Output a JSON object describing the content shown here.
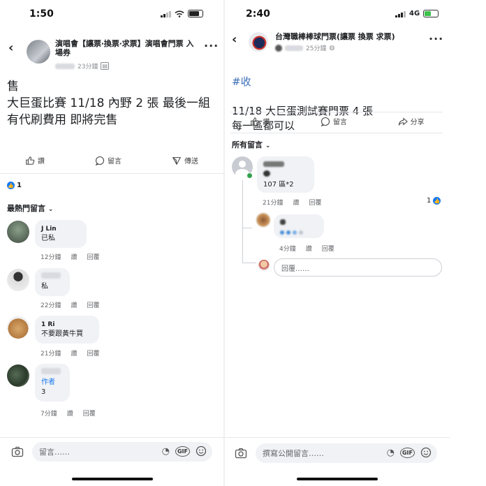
{
  "left": {
    "status_time": "1:50",
    "group_title": "演唱會【讓票‧換票‧求票】演唱會門票 入場券",
    "post_time": "23分鐘",
    "post_text": "售\n大巨蛋比賽 11/18 內野 2 張 最後一組\n有代刷費用 即將完售",
    "actions": {
      "like": "讚",
      "comment": "留言",
      "send": "傳送"
    },
    "like_count": "1",
    "sort_label": "最熱門留言",
    "comments": [
      {
        "name": "J Lin",
        "text": "已私",
        "time": "12分鐘",
        "like": "讚",
        "reply": "回覆"
      },
      {
        "name": "",
        "text": "私",
        "time": "22分鐘",
        "like": "讚",
        "reply": "回覆"
      },
      {
        "name": "1 Ri",
        "text": "不要跟黃牛買",
        "time": "21分鐘",
        "like": "讚",
        "reply": "回覆"
      },
      {
        "name": "",
        "badge": "作者",
        "text": "3",
        "time": "7分鐘",
        "like": "讚",
        "reply": "回覆"
      }
    ],
    "composer_placeholder": "留言……",
    "gif_label": "GIF"
  },
  "right": {
    "status_time": "2:40",
    "network": "4G",
    "group_title": "台灣職棒棒球門票(讓票 換票 求票)",
    "post_time": "25分鐘",
    "hashtag": "#收",
    "post_text": "11/18 大巨蛋測試賽門票 4 張\n每一區都可以",
    "actions": {
      "like": "讚",
      "comment": "留言",
      "share": "分享"
    },
    "sort_label": "所有留言",
    "comment": {
      "text": "107 區*2",
      "time": "21分鐘",
      "like": "讚",
      "reply": "回覆",
      "like_count": "1"
    },
    "reply": {
      "time": "4分鐘",
      "like": "讚",
      "reply": "回覆"
    },
    "reply_placeholder": "回覆……",
    "composer_placeholder": "撰寫公開留言……",
    "gif_label": "GIF"
  },
  "colors": {
    "accent": "#1877f2",
    "hashtag": "#3b6fb6",
    "bubble": "#f0f2f5",
    "muted": "#65676b"
  }
}
